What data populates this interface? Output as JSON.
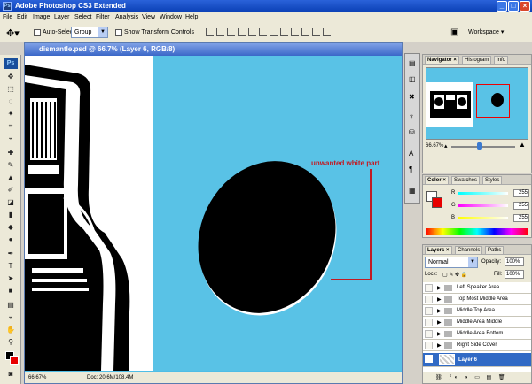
{
  "window": {
    "title": "Adobe Photoshop CS3 Extended",
    "minimize_label": "_",
    "maximize_label": "□",
    "close_label": "×"
  },
  "menu": {
    "items": [
      "File",
      "Edit",
      "Image",
      "Layer",
      "Select",
      "Filter",
      "Analysis",
      "View",
      "Window",
      "Help"
    ]
  },
  "options": {
    "auto_select_label": "Auto-Select:",
    "auto_select_value": "Group",
    "transform_label": "Show Transform Controls",
    "workspace_label": "Workspace ▾"
  },
  "toolbox": {
    "logo": "Ps"
  },
  "document": {
    "title": "dismantle.psd @ 66.7% (Layer 6, RGB/8)",
    "zoom": "66.67%",
    "doc_size": "Doc: 20.6M/108.4M",
    "annotation": "unwanted white part"
  },
  "navigator": {
    "tabs": [
      "Navigator",
      "Histogram",
      "Info"
    ],
    "zoom": "66.67%",
    "view_fraction": 0.45
  },
  "color": {
    "tabs": [
      "Color",
      "Swatches",
      "Styles"
    ],
    "channels": [
      {
        "ch": "R",
        "value": "255",
        "gradient": "linear-gradient(90deg,#00ffff,#ffffff)"
      },
      {
        "ch": "G",
        "value": "255",
        "gradient": "linear-gradient(90deg,#ff00ff,#ffffff)"
      },
      {
        "ch": "B",
        "value": "255",
        "gradient": "linear-gradient(90deg,#ffff00,#ffffff)"
      }
    ]
  },
  "layers": {
    "tabs": [
      "Layers",
      "Channels",
      "Paths"
    ],
    "blend_mode": "Normal",
    "opacity_label": "Opacity:",
    "opacity_value": "100%",
    "lock_label": "Lock:",
    "fill_label": "Fill:",
    "fill_value": "100%",
    "items": [
      "Left Speaker Area",
      "Top Most Middle Area",
      "Middle Top Area",
      "Middle Area Middle",
      "Middle Area Bottom",
      "Right Side Cover"
    ],
    "selected": "Layer 6"
  },
  "colors": {
    "canvas_blue": "#59c2e6",
    "annotation_red": "#c21b23",
    "selection_blue": "#316ac5"
  }
}
